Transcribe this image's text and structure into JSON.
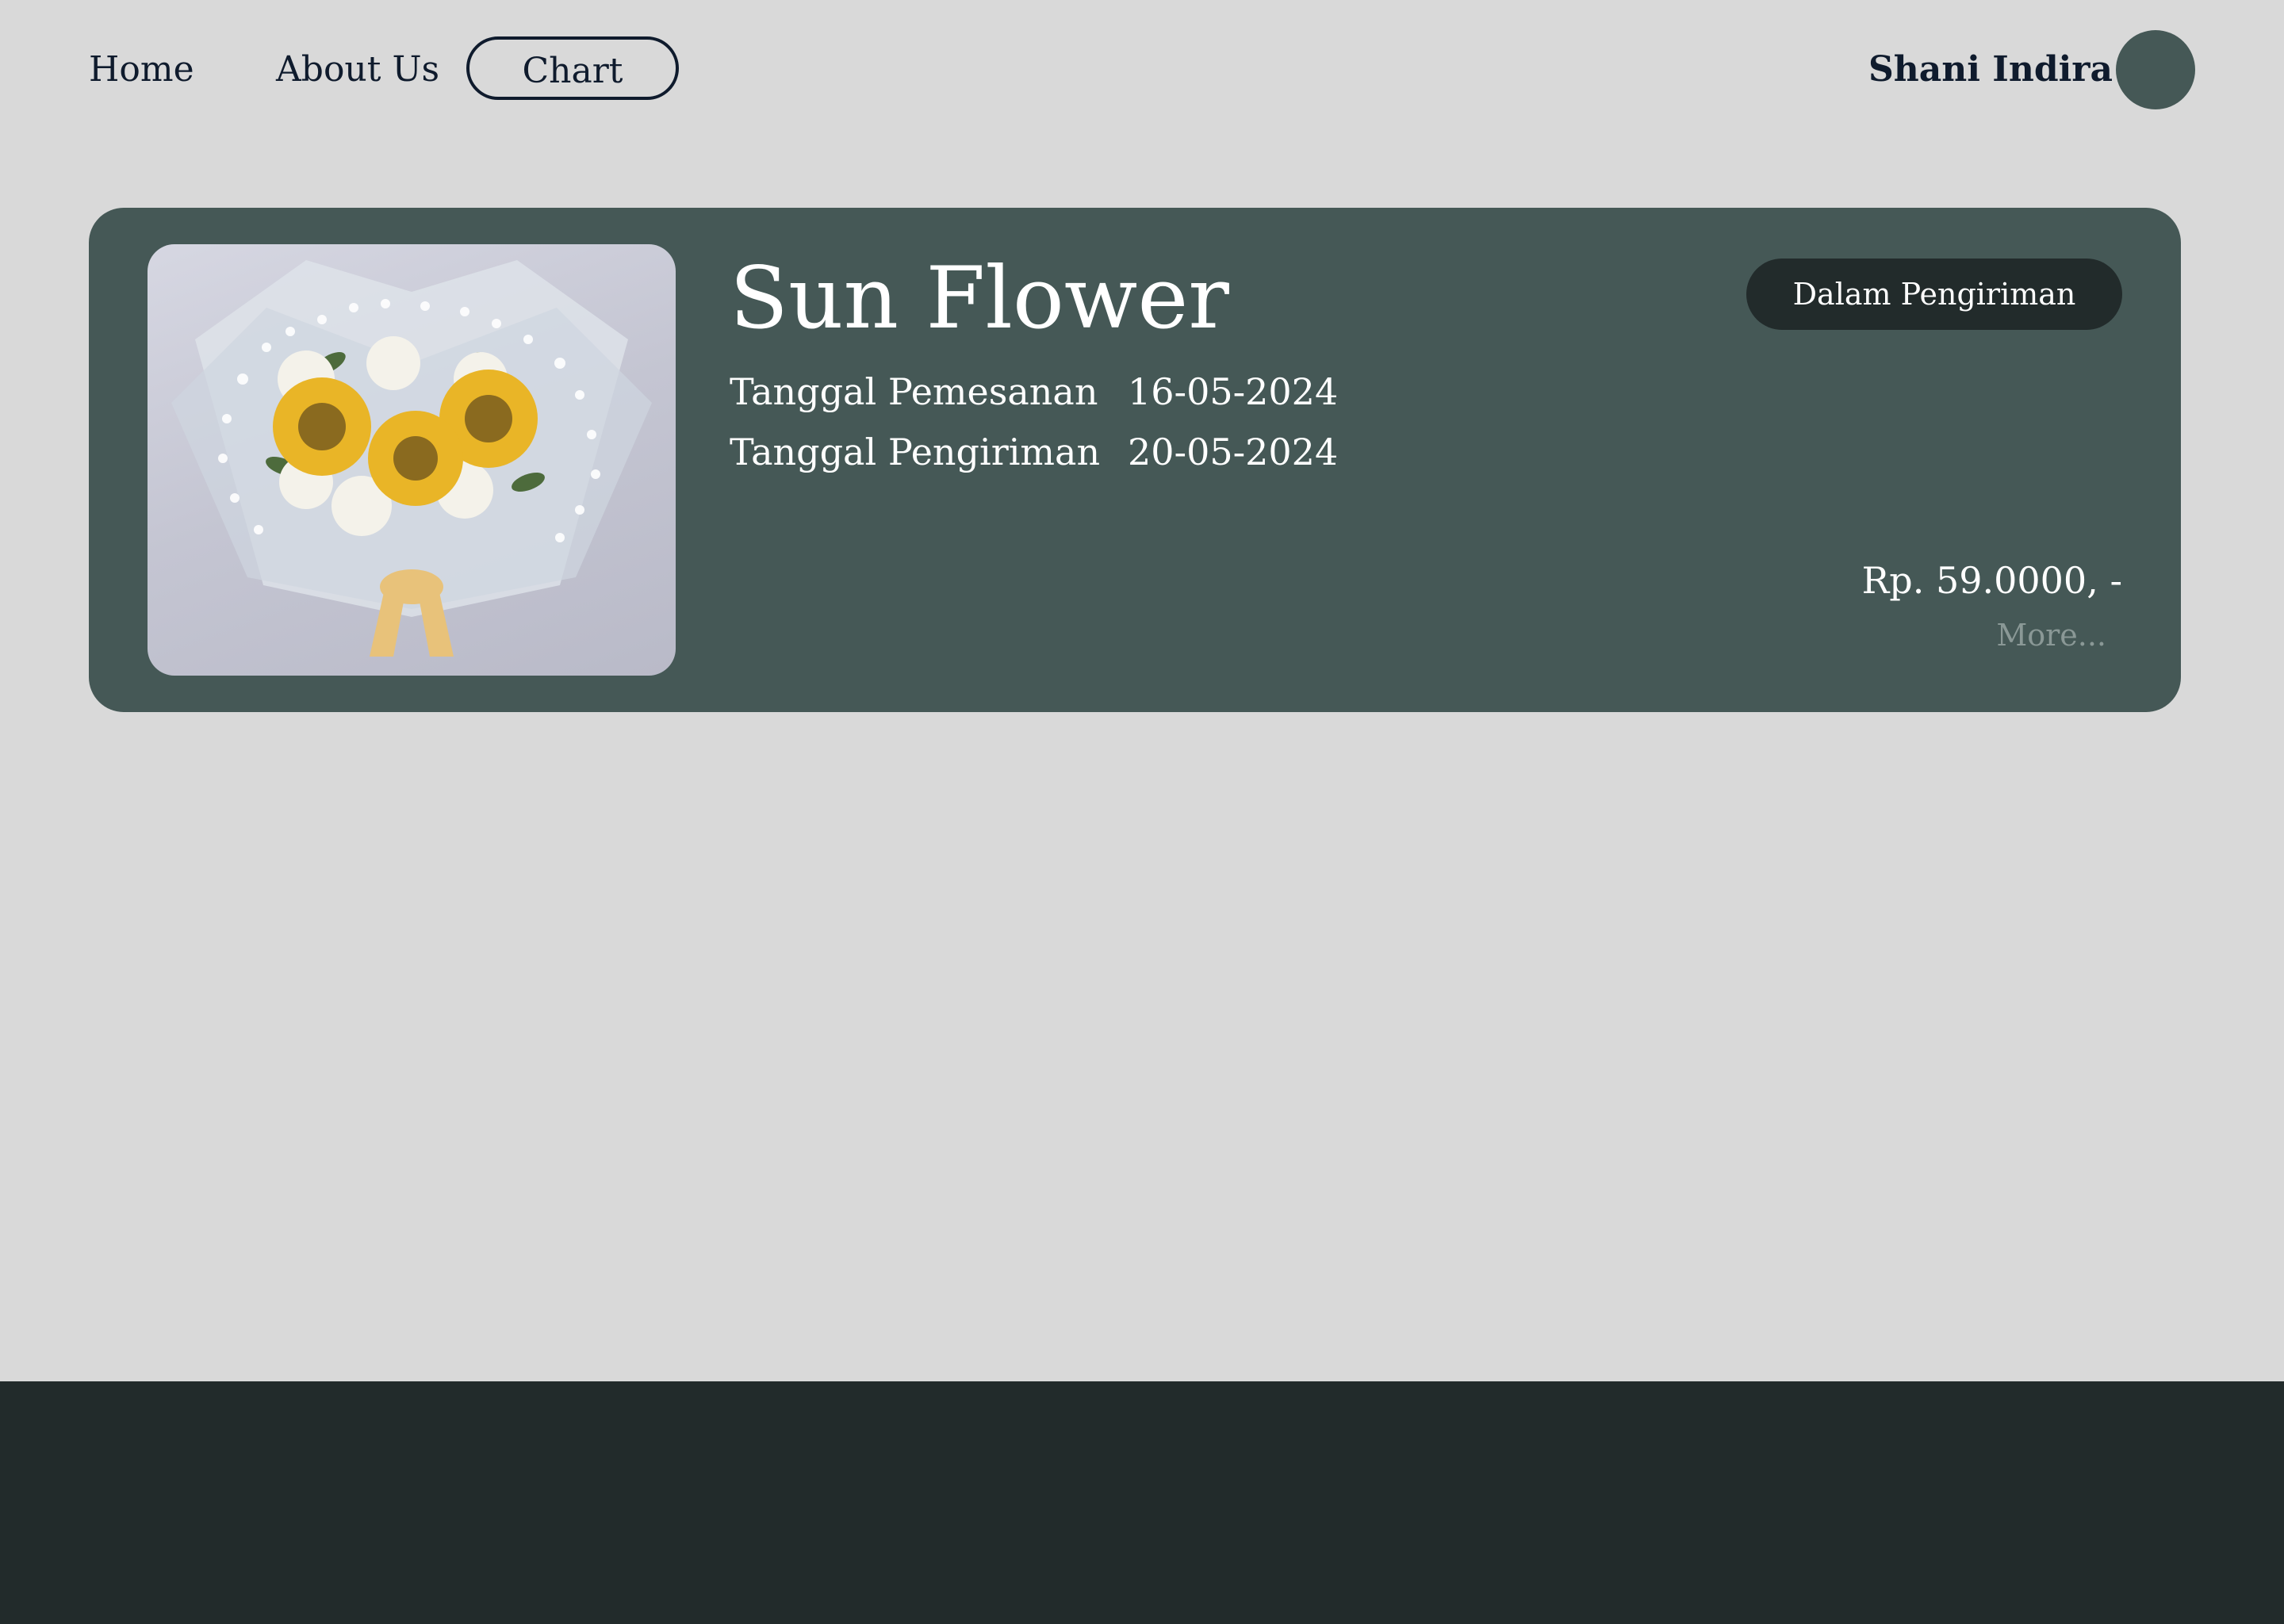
{
  "nav": {
    "home": "Home",
    "about": "About Us",
    "chart": "Chart"
  },
  "user": {
    "name": "Shani Indira"
  },
  "order": {
    "product_name": "Sun Flower",
    "status": "Dalam Pengiriman",
    "order_date_label": "Tanggal Pemesanan",
    "order_date": "16-05-2024",
    "ship_date_label": "Tanggal Pengiriman",
    "ship_date": "20-05-2024",
    "price": "Rp. 59.0000, -",
    "more": "More..."
  },
  "colors": {
    "background": "#d9d9d9",
    "card": "#455856",
    "dark": "#222b2b",
    "text_dark": "#0f1b2d",
    "muted": "#8a9896"
  }
}
